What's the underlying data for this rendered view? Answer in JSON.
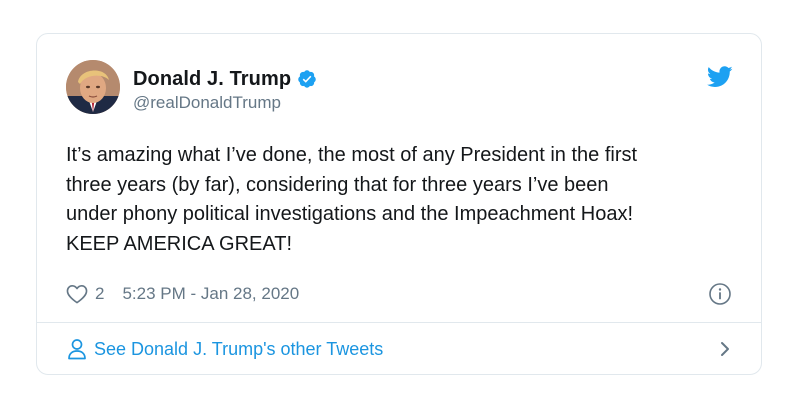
{
  "tweet": {
    "author": {
      "display_name": "Donald J. Trump",
      "handle": "@realDonaldTrump",
      "verified": true
    },
    "text": "It’s amazing what I’ve done, the most of any President in the first\nthree years (by far), considering that for three years I’ve been\nunder phony political investigations and the Impeachment Hoax!\nKEEP AMERICA GREAT!",
    "like_count": "2",
    "timestamp": "5:23 PM - Jan 28, 2020"
  },
  "footer": {
    "label": "See Donald J. Trump's other Tweets"
  },
  "icons": {
    "avatar": "avatar",
    "verified": "verified-badge-icon",
    "brand": "twitter-logo-icon",
    "like": "heart-icon",
    "info": "info-icon",
    "person": "person-icon",
    "chevron": "chevron-right-icon"
  },
  "colors": {
    "link": "#1b95e0",
    "verified": "#1da1f2",
    "text": "#14171a",
    "secondary": "#657786",
    "border": "#e1e8ed"
  }
}
